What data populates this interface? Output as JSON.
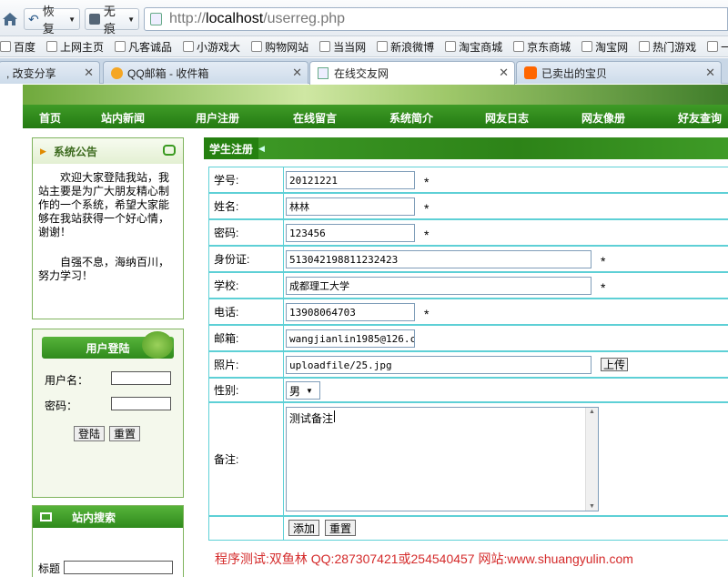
{
  "browser": {
    "back_label": "恢复",
    "no_trace_label": "无痕",
    "url_prefix": "http://",
    "url_host": "localhost",
    "url_path": "/userreg.php",
    "bookmarks": [
      "百度",
      "上网主页",
      "凡客诚品",
      "小游戏大",
      "购物网站",
      "当当网",
      "新浪微博",
      "淘宝商城",
      "京东商城",
      "淘宝网",
      "热门游戏",
      "一淘网"
    ],
    "tabs": [
      {
        "label": ", 改变分享"
      },
      {
        "label": "QQ邮箱 - 收件箱"
      },
      {
        "label": "在线交友网"
      },
      {
        "label": "已卖出的宝贝"
      }
    ]
  },
  "menu": [
    "首页",
    "站内新闻",
    "用户注册",
    "在线留言",
    "系统简介",
    "网友日志",
    "网友像册",
    "好友查询"
  ],
  "sidebar": {
    "notice_title": "系统公告",
    "notice_text_1": "欢迎大家登陆我站，我站主要是为广大朋友精心制作的一个系统，希望大家能够在我站获得一个好心情，谢谢！",
    "notice_text_2": "自强不息，海纳百川，努力学习！",
    "login_title": "用户登陆",
    "username_label": "用户名：",
    "password_label": "密码：",
    "login_button": "登陆",
    "reset_button": "重置",
    "search_title": "站内搜索",
    "search_label": "标题"
  },
  "form": {
    "title": "学生注册",
    "student_id_label": "学号:",
    "student_id": "20121221",
    "name_label": "姓名:",
    "name": "林林",
    "password_label": "密码:",
    "password": "123456",
    "idcard_label": "身份证:",
    "idcard": "513042198811232423",
    "school_label": "学校:",
    "school": "成都理工大学",
    "phone_label": "电话:",
    "phone": "13908064703",
    "email_label": "邮箱:",
    "email": "wangjianlin1985@126.c",
    "photo_label": "照片:",
    "photo": "uploadfile/25.jpg",
    "upload_button": "上传",
    "gender_label": "性别:",
    "gender": "男",
    "remark_label": "备注:",
    "remark": "测试备注",
    "add_button": "添加",
    "reset_button": "重置",
    "required_mark": "*"
  },
  "credit": "程序测试:双鱼林 QQ:287307421或254540457 网站:www.shuangyulin.com"
}
